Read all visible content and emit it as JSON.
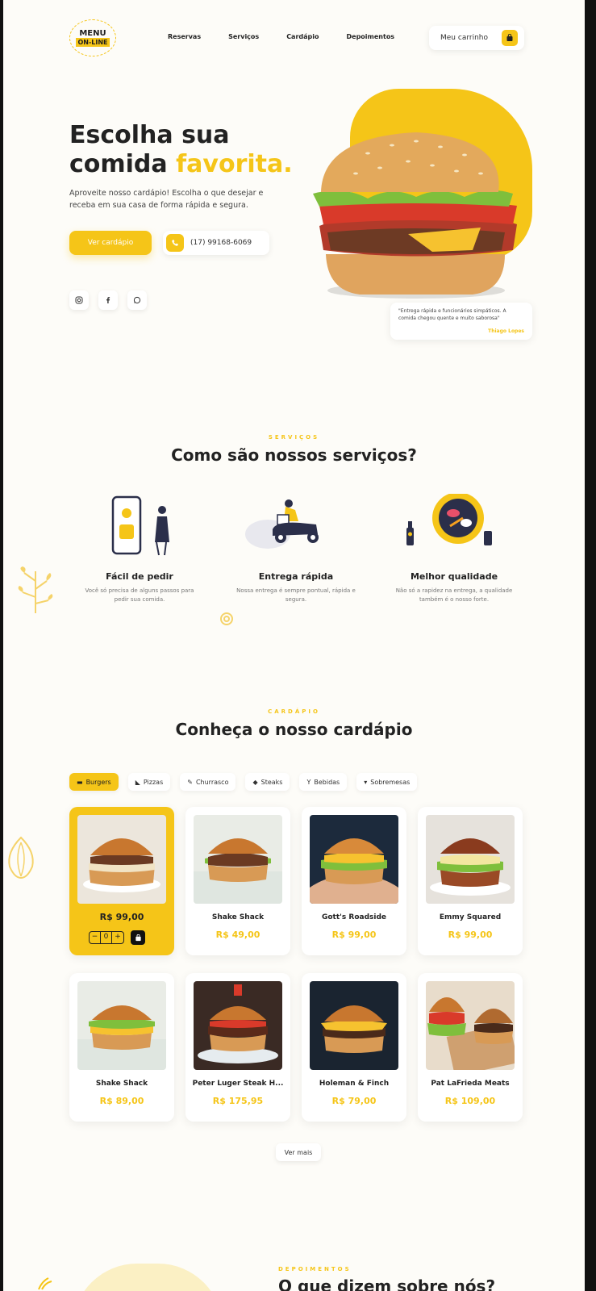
{
  "brand": {
    "line1": "MENU",
    "line2": "ON-LINE"
  },
  "nav": {
    "items": [
      "Reservas",
      "Serviços",
      "Cardápio",
      "Depoimentos"
    ]
  },
  "cart": {
    "label": "Meu carrinho",
    "icon": "shopping-bag-icon"
  },
  "hero": {
    "title_line1": "Escolha sua",
    "title_line2_plain": "comida ",
    "title_line2_highlight": "favorita.",
    "subtitle": "Aproveite nosso cardápio! Escolha o que desejar e receba em sua casa de forma rápida e segura.",
    "cta_label": "Ver cardápio",
    "phone": "(17) 99168-6069",
    "socials": [
      "instagram-icon",
      "facebook-icon",
      "whatsapp-icon"
    ],
    "testimonial": {
      "text": "\"Entrega rápida e funcionários simpáticos. A comida chegou quente e muito saborosa\"",
      "author": "Thiago Lopes"
    }
  },
  "services": {
    "eyebrow": "SERVIÇOS",
    "title": "Como são nossos serviços?",
    "items": [
      {
        "name": "Fácil de pedir",
        "desc": "Você só precisa de alguns passos para pedir sua comida."
      },
      {
        "name": "Entrega rápida",
        "desc": "Nossa entrega é sempre pontual, rápida e segura."
      },
      {
        "name": "Melhor qualidade",
        "desc": "Não só a rapidez na entrega, a qualidade também é o nosso forte."
      }
    ]
  },
  "menu": {
    "eyebrow": "CARDÁPIO",
    "title": "Conheça o nosso cardápio",
    "tabs": [
      {
        "label": "Burgers",
        "icon": "burger-icon",
        "active": true
      },
      {
        "label": "Pizzas",
        "icon": "pizza-icon",
        "active": false
      },
      {
        "label": "Churrasco",
        "icon": "grill-icon",
        "active": false
      },
      {
        "label": "Steaks",
        "icon": "steak-icon",
        "active": false
      },
      {
        "label": "Bebidas",
        "icon": "cocktail-icon",
        "active": false
      },
      {
        "label": "Sobremesas",
        "icon": "ice-cream-icon",
        "active": false
      }
    ],
    "cards": [
      {
        "name": "",
        "price": "R$ 99,00",
        "selected": true,
        "qty": "0"
      },
      {
        "name": "Shake Shack",
        "price": "R$ 49,00"
      },
      {
        "name": "Gott's Roadside",
        "price": "R$ 99,00"
      },
      {
        "name": "Emmy Squared",
        "price": "R$ 99,00"
      },
      {
        "name": "Shake Shack",
        "price": "R$ 89,00"
      },
      {
        "name": "Peter Luger Steak H...",
        "price": "R$ 175,95"
      },
      {
        "name": "Holeman & Finch",
        "price": "R$ 79,00"
      },
      {
        "name": "Pat LaFrieda Meats",
        "price": "R$ 109,00"
      }
    ],
    "more_label": "Ver mais"
  },
  "testimonials": {
    "eyebrow": "DEPOIMENTOS",
    "title": "O que dizem sobre nós?"
  },
  "colors": {
    "accent": "#f5c518",
    "background": "#fdfcf8",
    "text": "#222222"
  }
}
